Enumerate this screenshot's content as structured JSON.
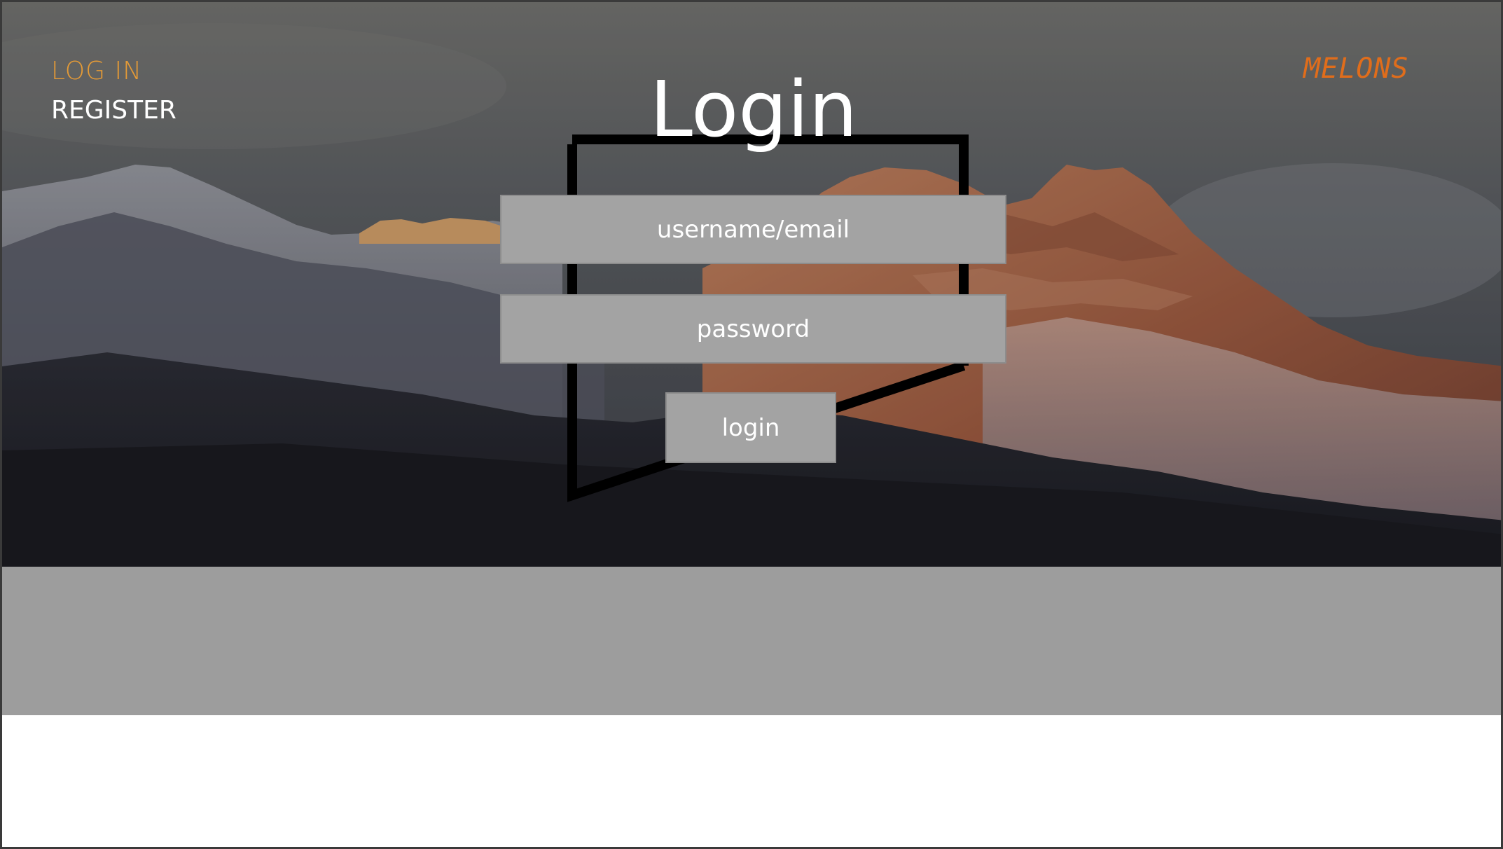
{
  "nav": {
    "login_label": "LOG IN",
    "register_label": "REGISTER"
  },
  "brand": {
    "name": "MELONS"
  },
  "page": {
    "title": "Login"
  },
  "form": {
    "username_placeholder": "username/email",
    "password_placeholder": "password",
    "submit_label": "login"
  },
  "colors": {
    "login_nav": "#e59b36",
    "brand": "#e06d1b",
    "field_bg": "#a3a3a3",
    "band": "#9d9d9d"
  }
}
